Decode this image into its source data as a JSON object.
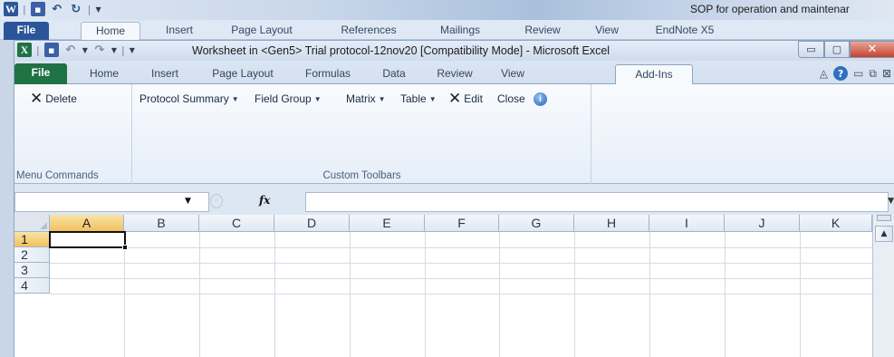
{
  "word": {
    "title": "SOP for operation and maintenar",
    "tabs": [
      "File",
      "Home",
      "Insert",
      "Page Layout",
      "References",
      "Mailings",
      "Review",
      "View",
      "EndNote X5"
    ]
  },
  "excel": {
    "title": "Worksheet in <Gen5> Trial protocol-12nov20  [Compatibility Mode]  -  Microsoft Excel",
    "tabs": [
      "File",
      "Home",
      "Insert",
      "Page Layout",
      "Formulas",
      "Data",
      "Review",
      "View",
      "Add-Ins"
    ],
    "active_tab": "Add-Ins"
  },
  "ribbon": {
    "menu_commands": {
      "delete_label": "Delete",
      "group_label": "Menu Commands"
    },
    "custom_toolbars": {
      "protocol_summary": "Protocol Summary",
      "field_group": "Field Group",
      "matrix": "Matrix",
      "table": "Table",
      "edit": "Edit",
      "close": "Close",
      "group_label": "Custom Toolbars"
    }
  },
  "formula_bar": {
    "name_box": "",
    "fx": "fx",
    "formula": ""
  },
  "grid": {
    "columns": [
      "A",
      "B",
      "C",
      "D",
      "E",
      "F",
      "G",
      "H",
      "I",
      "J",
      "K"
    ],
    "rows": [
      "1",
      "2",
      "3",
      "4"
    ],
    "selected_cell": "A1"
  },
  "colors": {
    "word_accent": "#2a5699",
    "excel_accent": "#1f7244",
    "close_red": "#c4432d",
    "header_highlight": "#f1c15f"
  }
}
